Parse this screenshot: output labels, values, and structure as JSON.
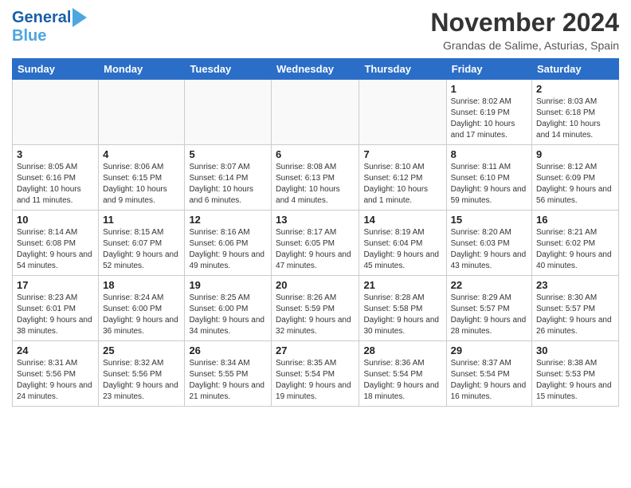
{
  "header": {
    "logo_line1": "General",
    "logo_line2": "Blue",
    "month": "November 2024",
    "location": "Grandas de Salime, Asturias, Spain"
  },
  "weekdays": [
    "Sunday",
    "Monday",
    "Tuesday",
    "Wednesday",
    "Thursday",
    "Friday",
    "Saturday"
  ],
  "weeks": [
    [
      {
        "day": "",
        "sunrise": "",
        "sunset": "",
        "daylight": "",
        "empty": true
      },
      {
        "day": "",
        "sunrise": "",
        "sunset": "",
        "daylight": "",
        "empty": true
      },
      {
        "day": "",
        "sunrise": "",
        "sunset": "",
        "daylight": "",
        "empty": true
      },
      {
        "day": "",
        "sunrise": "",
        "sunset": "",
        "daylight": "",
        "empty": true
      },
      {
        "day": "",
        "sunrise": "",
        "sunset": "",
        "daylight": "",
        "empty": true
      },
      {
        "day": "1",
        "sunrise": "Sunrise: 8:02 AM",
        "sunset": "Sunset: 6:19 PM",
        "daylight": "Daylight: 10 hours and 17 minutes.",
        "empty": false
      },
      {
        "day": "2",
        "sunrise": "Sunrise: 8:03 AM",
        "sunset": "Sunset: 6:18 PM",
        "daylight": "Daylight: 10 hours and 14 minutes.",
        "empty": false
      }
    ],
    [
      {
        "day": "3",
        "sunrise": "Sunrise: 8:05 AM",
        "sunset": "Sunset: 6:16 PM",
        "daylight": "Daylight: 10 hours and 11 minutes.",
        "empty": false
      },
      {
        "day": "4",
        "sunrise": "Sunrise: 8:06 AM",
        "sunset": "Sunset: 6:15 PM",
        "daylight": "Daylight: 10 hours and 9 minutes.",
        "empty": false
      },
      {
        "day": "5",
        "sunrise": "Sunrise: 8:07 AM",
        "sunset": "Sunset: 6:14 PM",
        "daylight": "Daylight: 10 hours and 6 minutes.",
        "empty": false
      },
      {
        "day": "6",
        "sunrise": "Sunrise: 8:08 AM",
        "sunset": "Sunset: 6:13 PM",
        "daylight": "Daylight: 10 hours and 4 minutes.",
        "empty": false
      },
      {
        "day": "7",
        "sunrise": "Sunrise: 8:10 AM",
        "sunset": "Sunset: 6:12 PM",
        "daylight": "Daylight: 10 hours and 1 minute.",
        "empty": false
      },
      {
        "day": "8",
        "sunrise": "Sunrise: 8:11 AM",
        "sunset": "Sunset: 6:10 PM",
        "daylight": "Daylight: 9 hours and 59 minutes.",
        "empty": false
      },
      {
        "day": "9",
        "sunrise": "Sunrise: 8:12 AM",
        "sunset": "Sunset: 6:09 PM",
        "daylight": "Daylight: 9 hours and 56 minutes.",
        "empty": false
      }
    ],
    [
      {
        "day": "10",
        "sunrise": "Sunrise: 8:14 AM",
        "sunset": "Sunset: 6:08 PM",
        "daylight": "Daylight: 9 hours and 54 minutes.",
        "empty": false
      },
      {
        "day": "11",
        "sunrise": "Sunrise: 8:15 AM",
        "sunset": "Sunset: 6:07 PM",
        "daylight": "Daylight: 9 hours and 52 minutes.",
        "empty": false
      },
      {
        "day": "12",
        "sunrise": "Sunrise: 8:16 AM",
        "sunset": "Sunset: 6:06 PM",
        "daylight": "Daylight: 9 hours and 49 minutes.",
        "empty": false
      },
      {
        "day": "13",
        "sunrise": "Sunrise: 8:17 AM",
        "sunset": "Sunset: 6:05 PM",
        "daylight": "Daylight: 9 hours and 47 minutes.",
        "empty": false
      },
      {
        "day": "14",
        "sunrise": "Sunrise: 8:19 AM",
        "sunset": "Sunset: 6:04 PM",
        "daylight": "Daylight: 9 hours and 45 minutes.",
        "empty": false
      },
      {
        "day": "15",
        "sunrise": "Sunrise: 8:20 AM",
        "sunset": "Sunset: 6:03 PM",
        "daylight": "Daylight: 9 hours and 43 minutes.",
        "empty": false
      },
      {
        "day": "16",
        "sunrise": "Sunrise: 8:21 AM",
        "sunset": "Sunset: 6:02 PM",
        "daylight": "Daylight: 9 hours and 40 minutes.",
        "empty": false
      }
    ],
    [
      {
        "day": "17",
        "sunrise": "Sunrise: 8:23 AM",
        "sunset": "Sunset: 6:01 PM",
        "daylight": "Daylight: 9 hours and 38 minutes.",
        "empty": false
      },
      {
        "day": "18",
        "sunrise": "Sunrise: 8:24 AM",
        "sunset": "Sunset: 6:00 PM",
        "daylight": "Daylight: 9 hours and 36 minutes.",
        "empty": false
      },
      {
        "day": "19",
        "sunrise": "Sunrise: 8:25 AM",
        "sunset": "Sunset: 6:00 PM",
        "daylight": "Daylight: 9 hours and 34 minutes.",
        "empty": false
      },
      {
        "day": "20",
        "sunrise": "Sunrise: 8:26 AM",
        "sunset": "Sunset: 5:59 PM",
        "daylight": "Daylight: 9 hours and 32 minutes.",
        "empty": false
      },
      {
        "day": "21",
        "sunrise": "Sunrise: 8:28 AM",
        "sunset": "Sunset: 5:58 PM",
        "daylight": "Daylight: 9 hours and 30 minutes.",
        "empty": false
      },
      {
        "day": "22",
        "sunrise": "Sunrise: 8:29 AM",
        "sunset": "Sunset: 5:57 PM",
        "daylight": "Daylight: 9 hours and 28 minutes.",
        "empty": false
      },
      {
        "day": "23",
        "sunrise": "Sunrise: 8:30 AM",
        "sunset": "Sunset: 5:57 PM",
        "daylight": "Daylight: 9 hours and 26 minutes.",
        "empty": false
      }
    ],
    [
      {
        "day": "24",
        "sunrise": "Sunrise: 8:31 AM",
        "sunset": "Sunset: 5:56 PM",
        "daylight": "Daylight: 9 hours and 24 minutes.",
        "empty": false
      },
      {
        "day": "25",
        "sunrise": "Sunrise: 8:32 AM",
        "sunset": "Sunset: 5:56 PM",
        "daylight": "Daylight: 9 hours and 23 minutes.",
        "empty": false
      },
      {
        "day": "26",
        "sunrise": "Sunrise: 8:34 AM",
        "sunset": "Sunset: 5:55 PM",
        "daylight": "Daylight: 9 hours and 21 minutes.",
        "empty": false
      },
      {
        "day": "27",
        "sunrise": "Sunrise: 8:35 AM",
        "sunset": "Sunset: 5:54 PM",
        "daylight": "Daylight: 9 hours and 19 minutes.",
        "empty": false
      },
      {
        "day": "28",
        "sunrise": "Sunrise: 8:36 AM",
        "sunset": "Sunset: 5:54 PM",
        "daylight": "Daylight: 9 hours and 18 minutes.",
        "empty": false
      },
      {
        "day": "29",
        "sunrise": "Sunrise: 8:37 AM",
        "sunset": "Sunset: 5:54 PM",
        "daylight": "Daylight: 9 hours and 16 minutes.",
        "empty": false
      },
      {
        "day": "30",
        "sunrise": "Sunrise: 8:38 AM",
        "sunset": "Sunset: 5:53 PM",
        "daylight": "Daylight: 9 hours and 15 minutes.",
        "empty": false
      }
    ]
  ]
}
